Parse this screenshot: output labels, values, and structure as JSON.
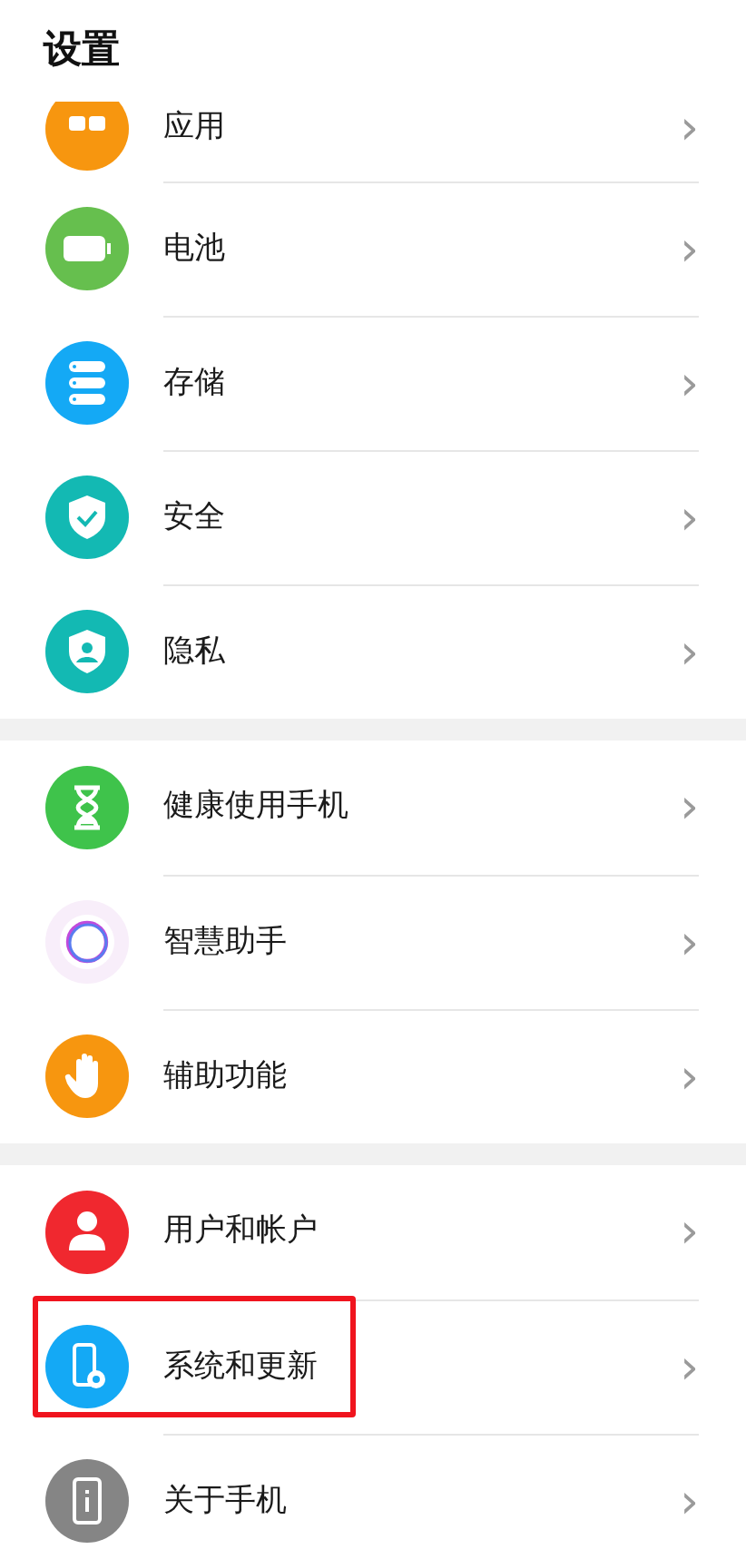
{
  "title": "设置",
  "groups": [
    {
      "items": [
        {
          "label": "应用",
          "chevron": "›",
          "highlighted": false
        },
        {
          "label": "电池",
          "chevron": "›",
          "highlighted": false
        },
        {
          "label": "存储",
          "chevron": "›",
          "highlighted": false
        },
        {
          "label": "安全",
          "chevron": "›",
          "highlighted": false
        },
        {
          "label": "隐私",
          "chevron": "›",
          "highlighted": false
        }
      ]
    },
    {
      "items": [
        {
          "label": "健康使用手机",
          "chevron": "›",
          "highlighted": false
        },
        {
          "label": "智慧助手",
          "chevron": "›",
          "highlighted": false
        },
        {
          "label": "辅助功能",
          "chevron": "›",
          "highlighted": false
        }
      ]
    },
    {
      "items": [
        {
          "label": "用户和帐户",
          "chevron": "›",
          "highlighted": false
        },
        {
          "label": "系统和更新",
          "chevron": "›",
          "highlighted": true
        },
        {
          "label": "关于手机",
          "chevron": "›",
          "highlighted": false
        }
      ]
    }
  ]
}
